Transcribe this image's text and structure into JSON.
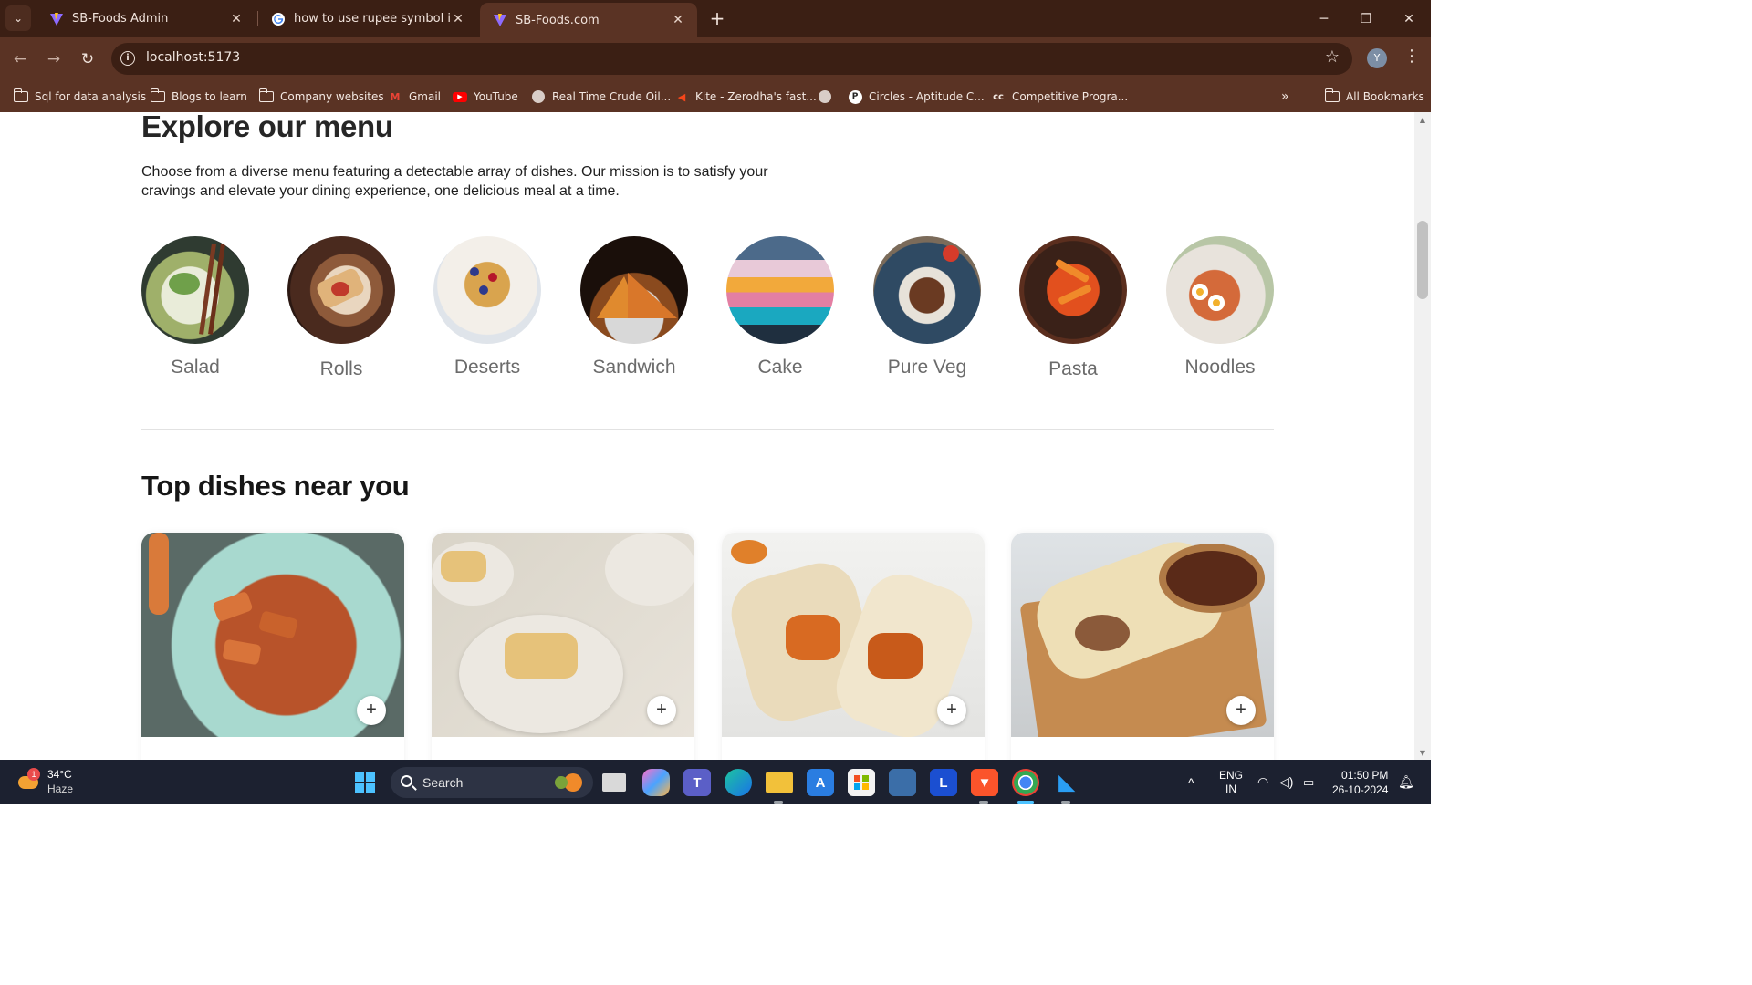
{
  "browser": {
    "tabs": [
      {
        "title": "SB-Foods Admin",
        "favicon": "vite-logo-icon",
        "active": false
      },
      {
        "title": "how to use rupee symbol in key",
        "favicon": "google-g-icon",
        "active": false
      },
      {
        "title": "SB-Foods.com",
        "favicon": "vite-logo-icon",
        "active": true
      }
    ],
    "url": "localhost:5173",
    "profile_initial": "Y",
    "bookmarks": [
      {
        "label": "Sql for data analysis",
        "icon": "folder-icon"
      },
      {
        "label": "Blogs to learn",
        "icon": "folder-icon"
      },
      {
        "label": "Company websites",
        "icon": "folder-icon"
      },
      {
        "label": "Gmail",
        "icon": "gmail-icon"
      },
      {
        "label": "YouTube",
        "icon": "youtube-icon"
      },
      {
        "label": "Real Time Crude Oil...",
        "icon": "globe-icon"
      },
      {
        "label": "Kite - Zerodha's fast...",
        "icon": "kite-icon"
      },
      {
        "label": "",
        "icon": "globe-icon"
      },
      {
        "label": "Circles - Aptitude C...",
        "icon": "p-icon"
      },
      {
        "label": "Competitive Progra...",
        "icon": "cc-icon"
      }
    ],
    "all_bookmarks": "All Bookmarks"
  },
  "menu": {
    "title": "Explore our menu",
    "description": "Choose from a diverse menu featuring a detectable array of dishes. Our mission is to satisfy your cravings and elevate your dining experience, one delicious meal at a time.",
    "categories": [
      {
        "label": "Salad"
      },
      {
        "label": "Rolls"
      },
      {
        "label": "Deserts"
      },
      {
        "label": "Sandwich"
      },
      {
        "label": "Cake"
      },
      {
        "label": "Pure Veg"
      },
      {
        "label": "Pasta"
      },
      {
        "label": "Noodles"
      }
    ]
  },
  "top_dishes": {
    "title": "Top dishes near you",
    "add_symbol": "+"
  },
  "taskbar": {
    "temperature": "34°C",
    "weather": "Haze",
    "weather_badge": "1",
    "search_label": "Search",
    "language": "ENG",
    "region": "IN",
    "time": "01:50 PM",
    "date": "26-10-2024"
  },
  "colors": {
    "chrome_dark": "#3b1f14",
    "chrome": "#5a3324",
    "taskbar": "#1c2130"
  }
}
